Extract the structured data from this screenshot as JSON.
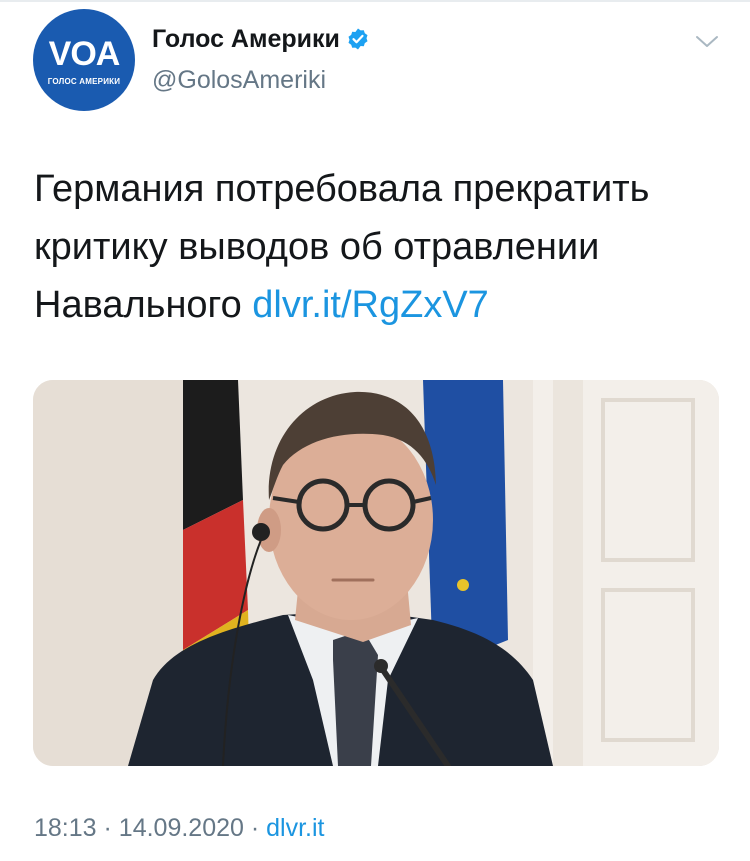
{
  "tweet": {
    "avatar": {
      "logo_text": "VOA",
      "logo_subtext": "ГОЛОС АМЕРИКИ",
      "brand_color": "#1a5bb0"
    },
    "display_name": "Голос Америки",
    "verified_icon": "verified-badge-icon",
    "handle": "@GolosAmeriki",
    "text_main": "Германия потребовала прекратить критику выводов об отравлении Навального ",
    "link_text": "dlvr.it/RgZxV7",
    "time": "18:13",
    "separator_1": "·",
    "date": "14.09.2020",
    "separator_2": "·",
    "source": "dlvr.it",
    "colors": {
      "link": "#1b95e0",
      "secondary_text": "#657786",
      "primary_text": "#14171a"
    }
  }
}
